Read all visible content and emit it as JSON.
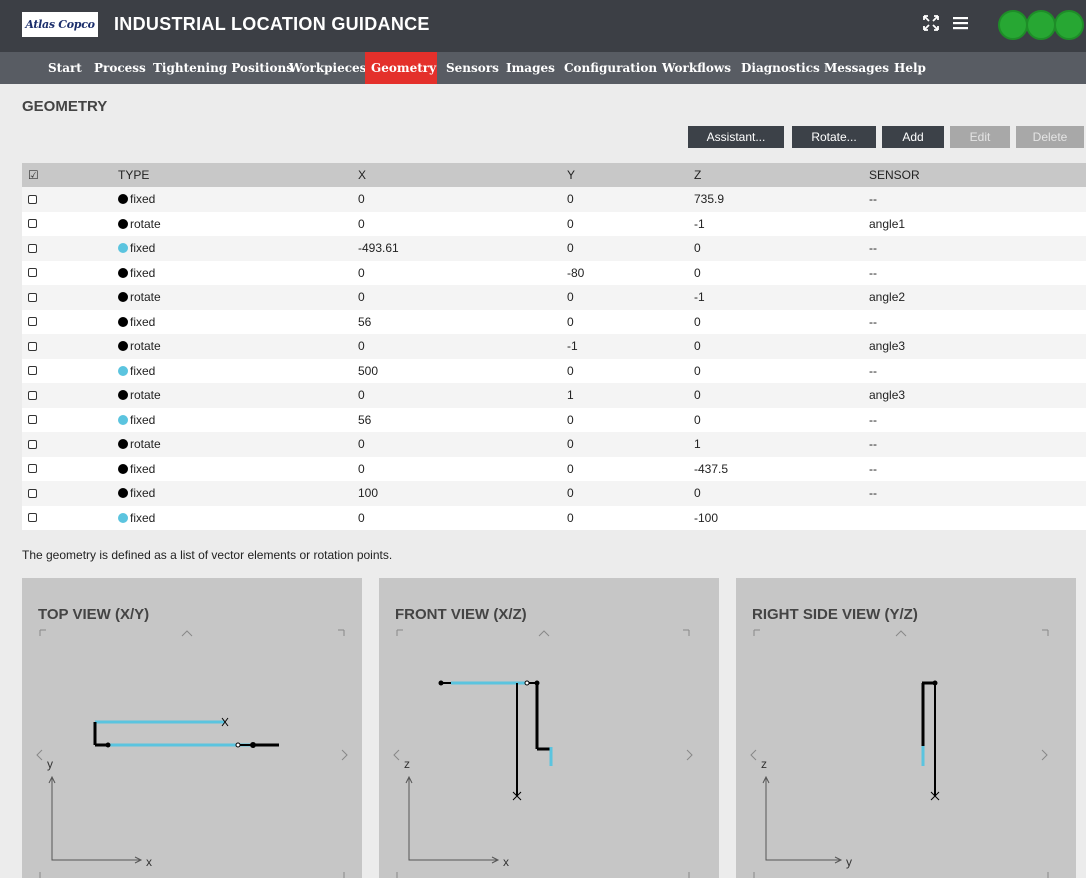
{
  "header": {
    "logo_text": "Atlas Copco",
    "title": "INDUSTRIAL LOCATION GUIDANCE",
    "icons": [
      "fullscreen-icon",
      "menu-icon"
    ],
    "status_color": "#27a733"
  },
  "nav": {
    "items": [
      "Start",
      "Process",
      "Tightening Positions",
      "Workpieces",
      "Geometry",
      "Sensors",
      "Images",
      "Configuration",
      "Workflows",
      "Diagnostics",
      "Messages",
      "Help"
    ],
    "active": "Geometry",
    "active_color": "#e4302b"
  },
  "page": {
    "title": "GEOMETRY"
  },
  "buttons": {
    "assistant": "Assistant...",
    "rotate": "Rotate...",
    "add": "Add",
    "edit": "Edit",
    "delete": "Delete"
  },
  "table": {
    "headers": {
      "type": "TYPE",
      "x": "X",
      "y": "Y",
      "z": "Z",
      "sensor": "SENSOR"
    },
    "rows": [
      {
        "dot": "#000000",
        "type": "fixed",
        "x": "0",
        "y": "0",
        "z": "735.9",
        "sensor": "--"
      },
      {
        "dot": "#000000",
        "type": "rotate",
        "x": "0",
        "y": "0",
        "z": "-1",
        "sensor": "angle1"
      },
      {
        "dot": "#5bc4df",
        "type": "fixed",
        "x": "-493.61",
        "y": "0",
        "z": "0",
        "sensor": "--"
      },
      {
        "dot": "#000000",
        "type": "fixed",
        "x": "0",
        "y": "-80",
        "z": "0",
        "sensor": "--"
      },
      {
        "dot": "#000000",
        "type": "rotate",
        "x": "0",
        "y": "0",
        "z": "-1",
        "sensor": "angle2"
      },
      {
        "dot": "#000000",
        "type": "fixed",
        "x": "56",
        "y": "0",
        "z": "0",
        "sensor": "--"
      },
      {
        "dot": "#000000",
        "type": "rotate",
        "x": "0",
        "y": "-1",
        "z": "0",
        "sensor": "angle3"
      },
      {
        "dot": "#5bc4df",
        "type": "fixed",
        "x": "500",
        "y": "0",
        "z": "0",
        "sensor": "--"
      },
      {
        "dot": "#000000",
        "type": "rotate",
        "x": "0",
        "y": "1",
        "z": "0",
        "sensor": "angle3"
      },
      {
        "dot": "#5bc4df",
        "type": "fixed",
        "x": "56",
        "y": "0",
        "z": "0",
        "sensor": "--"
      },
      {
        "dot": "#000000",
        "type": "rotate",
        "x": "0",
        "y": "0",
        "z": "1",
        "sensor": "--"
      },
      {
        "dot": "#000000",
        "type": "fixed",
        "x": "0",
        "y": "0",
        "z": "-437.5",
        "sensor": "--"
      },
      {
        "dot": "#000000",
        "type": "fixed",
        "x": "100",
        "y": "0",
        "z": "0",
        "sensor": "--"
      },
      {
        "dot": "#5bc4df",
        "type": "fixed",
        "x": "0",
        "y": "0",
        "z": "-100",
        "sensor": ""
      }
    ]
  },
  "note": "The geometry is defined as a list of vector elements or rotation points.",
  "views": [
    {
      "title": "TOP VIEW (X/Y)",
      "axis_h": "x",
      "axis_v": "y"
    },
    {
      "title": "FRONT VIEW (X/Z)",
      "axis_h": "x",
      "axis_v": "z"
    },
    {
      "title": "RIGHT SIDE VIEW (Y/Z)",
      "axis_h": "y",
      "axis_v": "z"
    }
  ],
  "colors": {
    "fixed_black": "#000000",
    "fixed_cyan": "#5bc4df"
  }
}
